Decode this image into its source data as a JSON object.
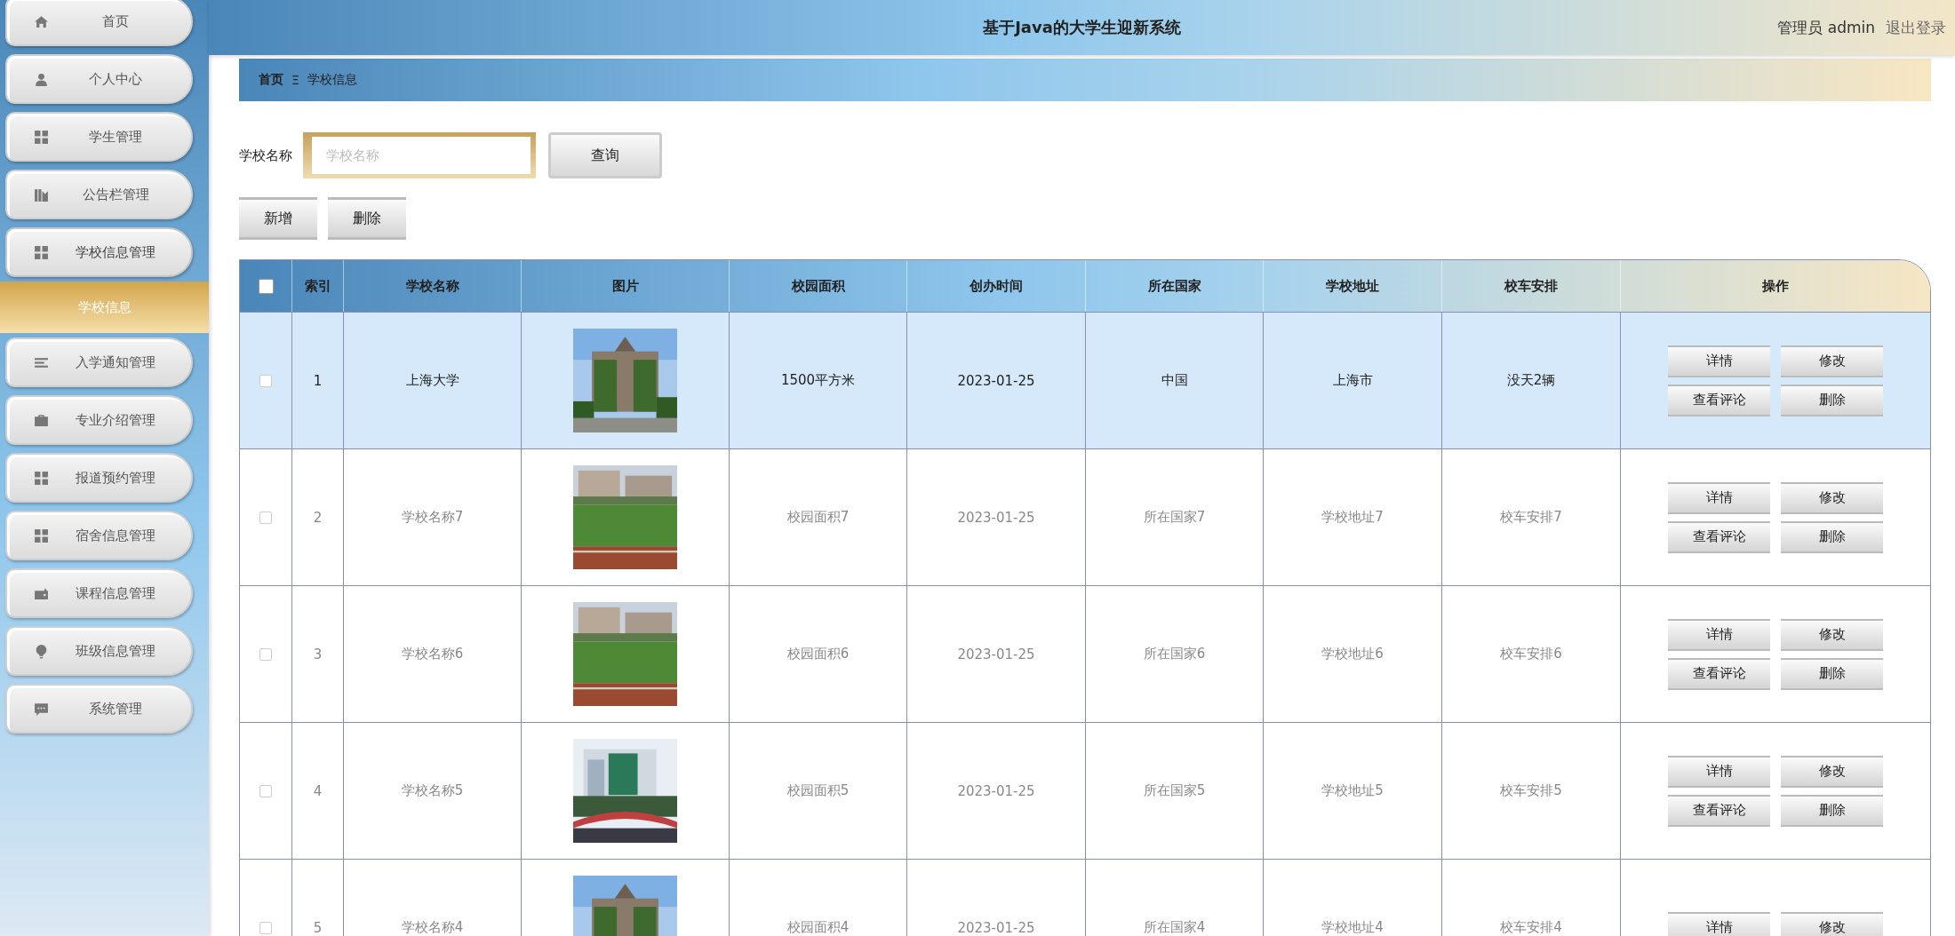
{
  "header": {
    "title": "基于Java的大学生迎新系统",
    "user": "管理员 admin",
    "logout": "退出登录"
  },
  "sidebar": {
    "items": [
      {
        "label": "首页",
        "kind": "home"
      },
      {
        "label": "个人中心",
        "kind": "user"
      },
      {
        "label": "学生管理",
        "kind": "grid"
      },
      {
        "label": "公告栏管理",
        "kind": "book"
      },
      {
        "label": "学校信息管理",
        "kind": "grid",
        "expanded": true,
        "children": [
          {
            "label": "学校信息",
            "selected": true
          }
        ]
      },
      {
        "label": "入学通知管理",
        "kind": "list"
      },
      {
        "label": "专业介绍管理",
        "kind": "briefcase"
      },
      {
        "label": "报道预约管理",
        "kind": "grid"
      },
      {
        "label": "宿舍信息管理",
        "kind": "grid"
      },
      {
        "label": "课程信息管理",
        "kind": "wallet"
      },
      {
        "label": "班级信息管理",
        "kind": "bulb"
      },
      {
        "label": "系统管理",
        "kind": "chat"
      }
    ]
  },
  "breadcrumb": {
    "items": [
      "首页",
      "学校信息"
    ],
    "separator": "Ξ"
  },
  "search": {
    "label": "学校名称",
    "placeholder": "学校名称",
    "button": "查询"
  },
  "actions": [
    "新增",
    "删除"
  ],
  "table": {
    "select_all_checked": false,
    "columns": [
      "索引",
      "学校名称",
      "图片",
      "校园面积",
      "创办时间",
      "所在国家",
      "学校地址",
      "校车安排",
      "操作"
    ],
    "rows": [
      {
        "selected": true,
        "checked": false,
        "index": "1",
        "name": "上海大学",
        "picture": {
          "kind": "picture"
        },
        "area": "1500平方米",
        "founded": "2023-01-25",
        "country": "中国",
        "address": "上海市",
        "bus": "没天2辆",
        "buttons": [
          "详情",
          "修改",
          "查看评论",
          "删除"
        ]
      },
      {
        "selected": false,
        "checked": false,
        "index": "2",
        "name": "学校名称7",
        "picture": {
          "kind": "picture"
        },
        "area": "校园面积7",
        "founded": "2023-01-25",
        "country": "所在国家7",
        "address": "学校地址7",
        "bus": "校车安排7",
        "buttons": [
          "详情",
          "修改",
          "查看评论",
          "删除"
        ]
      },
      {
        "selected": false,
        "checked": false,
        "index": "3",
        "name": "学校名称6",
        "picture": {
          "kind": "picture"
        },
        "area": "校园面积6",
        "founded": "2023-01-25",
        "country": "所在国家6",
        "address": "学校地址6",
        "bus": "校车安排6",
        "buttons": [
          "详情",
          "修改",
          "查看评论",
          "删除"
        ]
      },
      {
        "selected": false,
        "checked": false,
        "index": "4",
        "name": "学校名称5",
        "picture": {
          "kind": "picture"
        },
        "area": "校园面积5",
        "founded": "2023-01-25",
        "country": "所在国家5",
        "address": "学校地址5",
        "bus": "校车安排5",
        "buttons": [
          "详情",
          "修改",
          "查看评论",
          "删除"
        ]
      },
      {
        "selected": false,
        "checked": false,
        "index": "5",
        "name": "学校名称4",
        "picture": {
          "kind": "picture"
        },
        "area": "校园面积4",
        "founded": "2023-01-25",
        "country": "所在国家4",
        "address": "学校地址4",
        "bus": "校车安排4",
        "buttons": [
          "详情",
          "修改"
        ]
      }
    ]
  }
}
